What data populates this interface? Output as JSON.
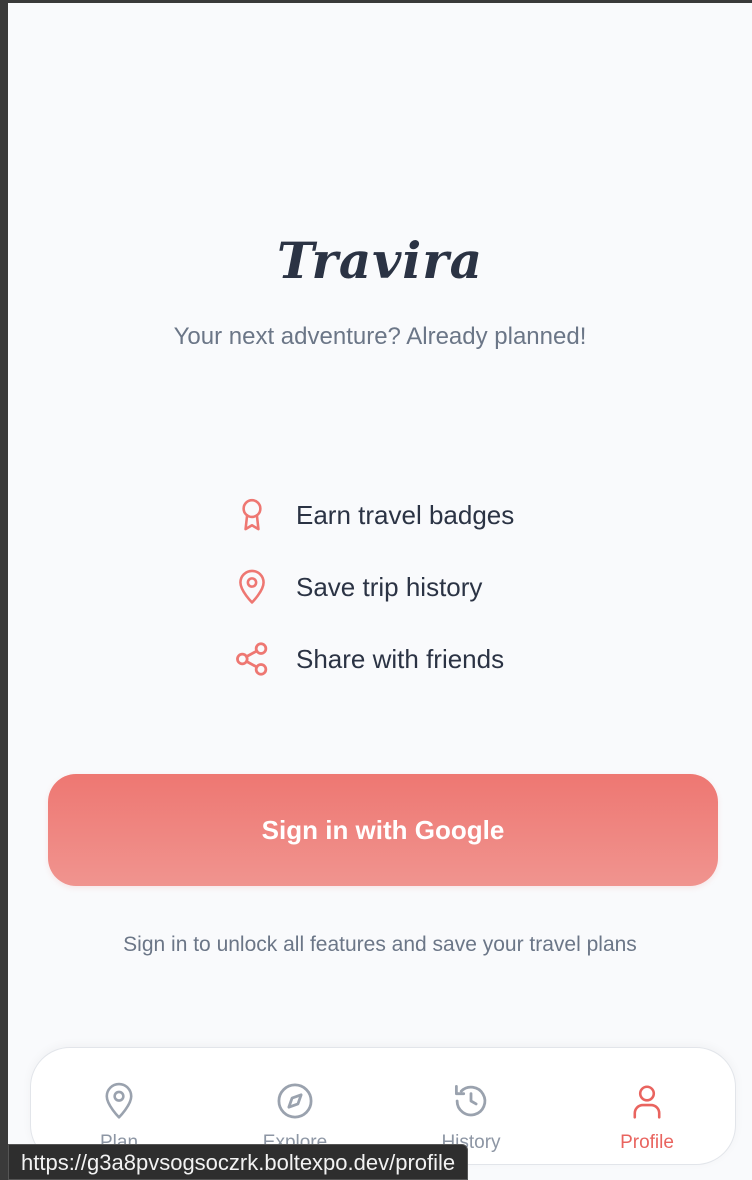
{
  "app": {
    "title": "Travira",
    "tagline": "Your next adventure? Already planned!"
  },
  "features": [
    {
      "icon": "award-icon",
      "label": "Earn travel badges"
    },
    {
      "icon": "map-pin-icon",
      "label": "Save trip history"
    },
    {
      "icon": "share-icon",
      "label": "Share with friends"
    }
  ],
  "auth": {
    "google_button_label": "Sign in with Google",
    "hint": "Sign in to unlock all features and save your travel plans"
  },
  "tabbar": {
    "tabs": [
      {
        "icon": "map-pin-icon",
        "label": "Plan",
        "active": false
      },
      {
        "icon": "compass-icon",
        "label": "Explore",
        "active": false
      },
      {
        "icon": "history-icon",
        "label": "History",
        "active": false
      },
      {
        "icon": "user-icon",
        "label": "Profile",
        "active": true
      }
    ]
  },
  "status_bar": {
    "url": "https://g3a8pvsogsoczrk.boltexpo.dev/profile"
  },
  "colors": {
    "accent": "#ee7772",
    "text_dark": "#2b3344",
    "text_muted": "#6b7687",
    "tab_inactive": "#8d96a4",
    "background": "#f9fafc"
  }
}
